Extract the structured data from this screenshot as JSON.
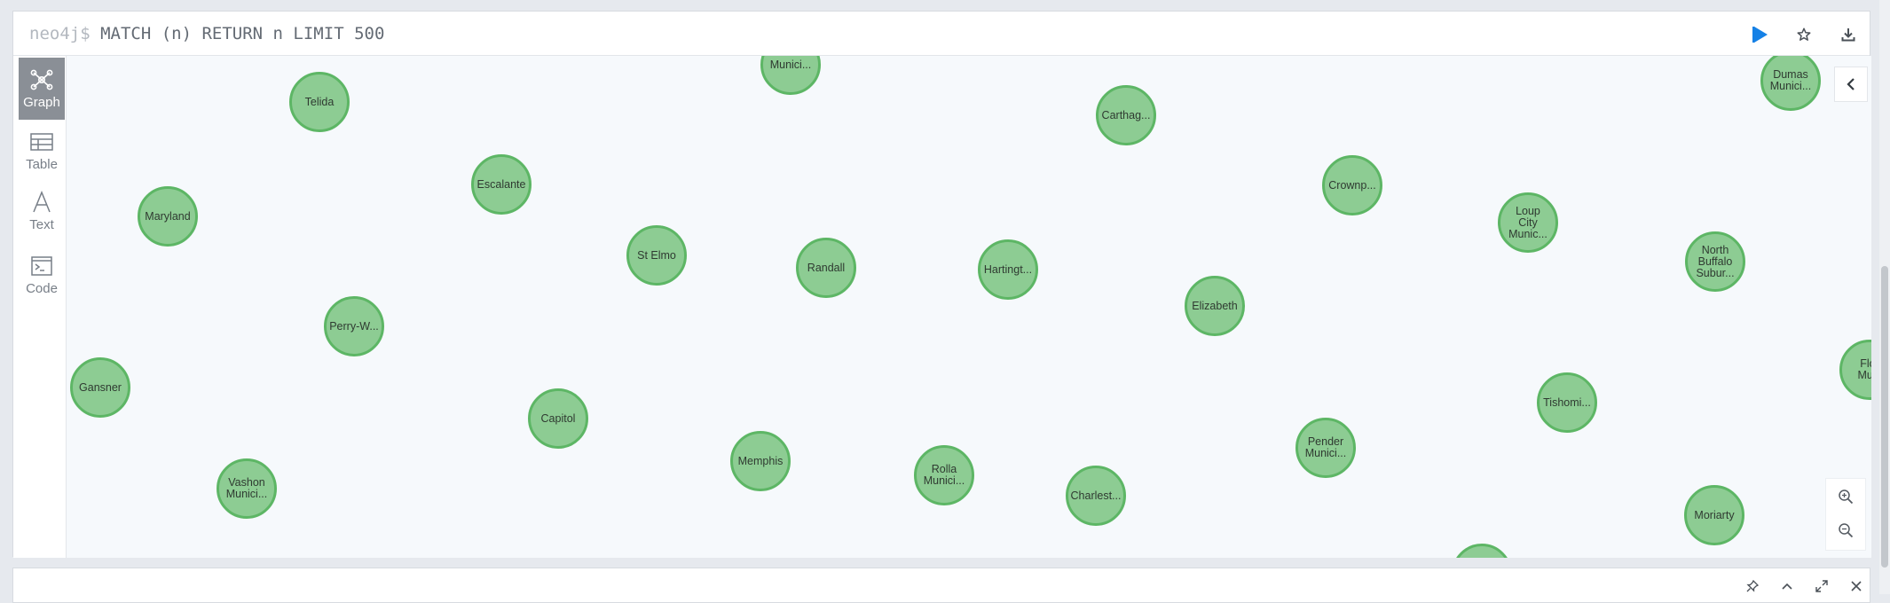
{
  "query": {
    "prompt": "neo4j$",
    "text": "MATCH (n) RETURN n LIMIT 500"
  },
  "query_actions": {
    "run_icon": "play-icon",
    "favorite_icon": "star-icon",
    "download_icon": "download-icon"
  },
  "views": [
    {
      "label": "Graph",
      "icon": "graph-icon",
      "active": true
    },
    {
      "label": "Table",
      "icon": "table-icon",
      "active": false
    },
    {
      "label": "Text",
      "icon": "text-icon",
      "active": false
    },
    {
      "label": "Code",
      "icon": "code-icon",
      "active": false
    }
  ],
  "nodes": [
    "Telida",
    "Munici...",
    "Carthag...",
    "Dumas\nMunici...",
    "Escalante",
    "Crownp...",
    "Maryland",
    "Loup\nCity\nMunic...",
    "St Elmo",
    "Randall",
    "Hartingt...",
    "North\nBuffalo\nSubur...",
    "Elizabeth",
    "Perry-W...",
    "Flor\nMuni",
    "Gansner",
    "Capitol",
    "Tishomi...",
    "Pender\nMunici...",
    "Memphis",
    "Rolla\nMunici...",
    "Vashon\nMunici...",
    "Charlest...",
    "Moriarty",
    ""
  ],
  "colors": {
    "node_fill": "#8dcc93",
    "node_border": "#5db665",
    "run_button": "#1581e6",
    "active_view": "#8a8f96"
  }
}
